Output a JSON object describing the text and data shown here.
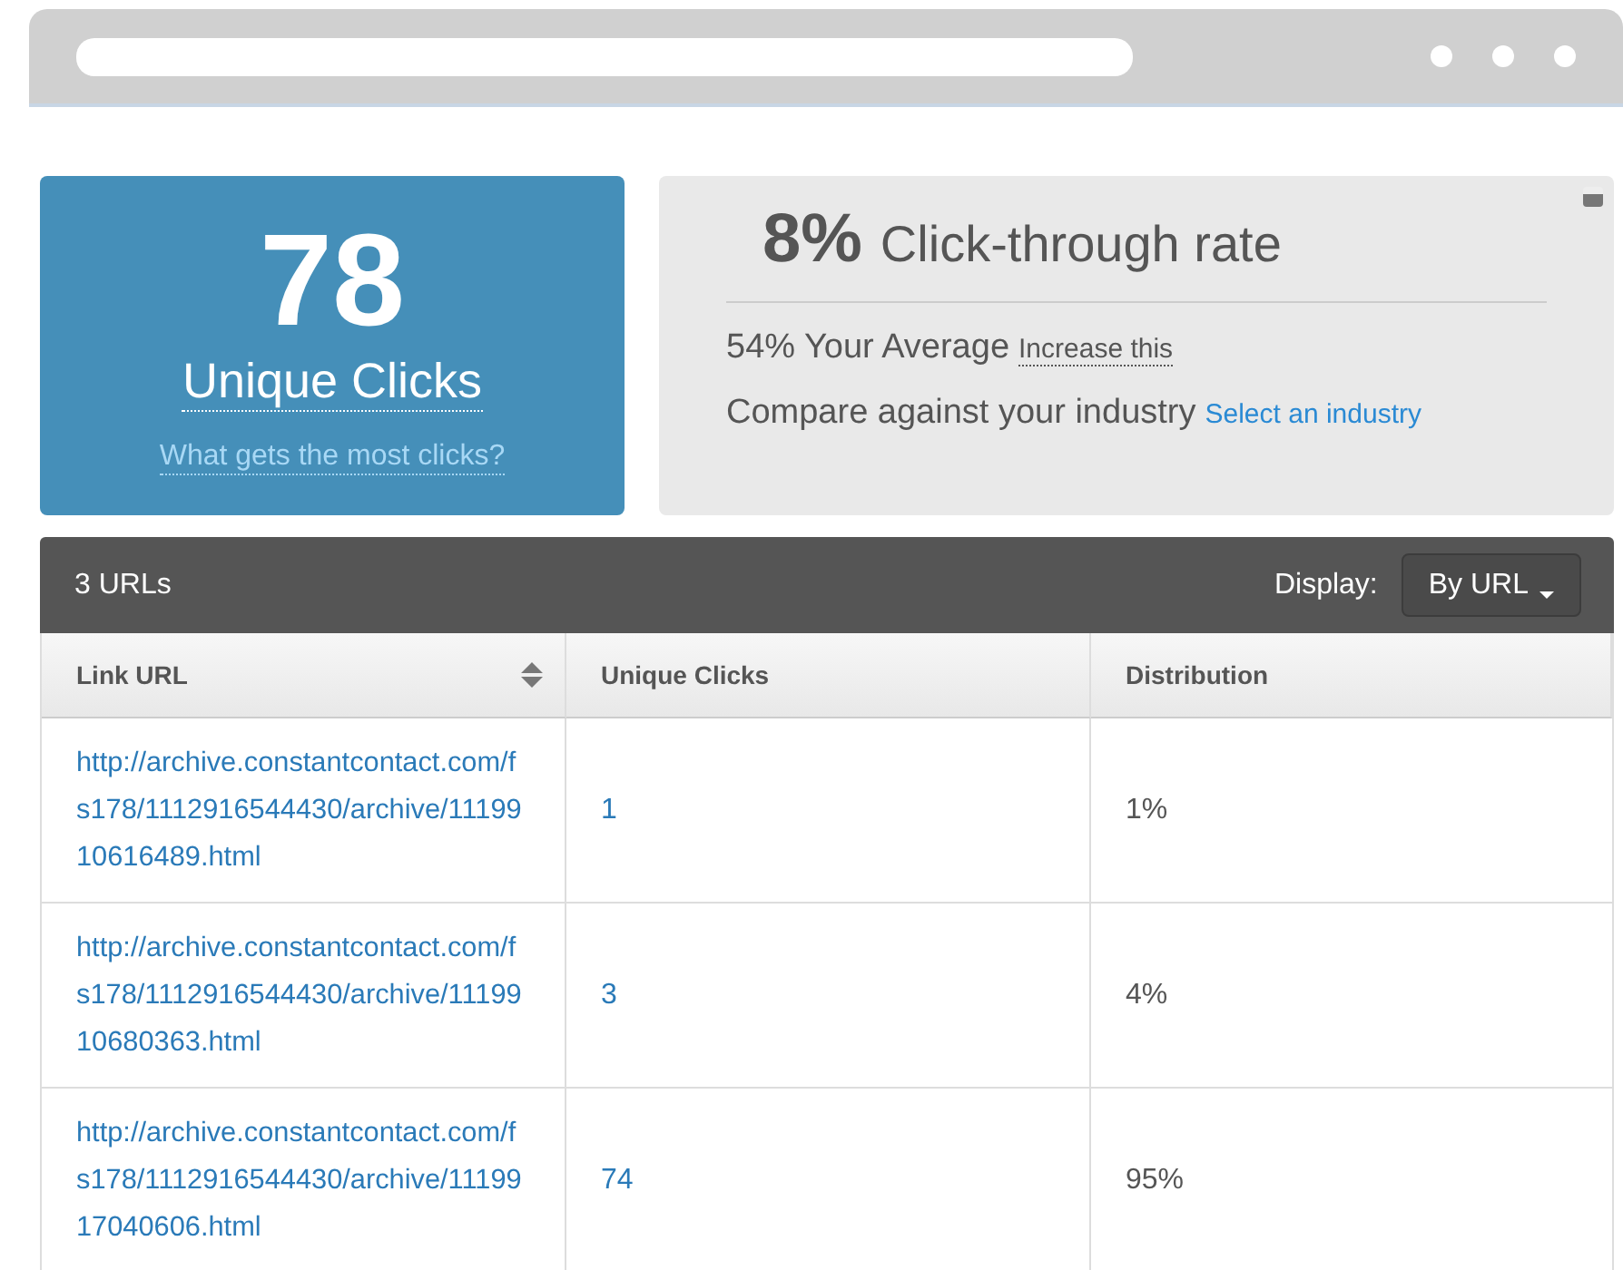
{
  "summary": {
    "count": "78",
    "label": "Unique Clicks",
    "link": "What gets the most clicks?"
  },
  "rate": {
    "value": "8%",
    "label": "Click-through rate",
    "average_value": "54% Your Average",
    "average_link": "Increase this",
    "compare_label": "Compare against your industry",
    "compare_link": "Select an industry"
  },
  "table": {
    "count": "3 URLs",
    "display_label": "Display:",
    "display_value": "By URL",
    "columns": [
      {
        "label": "Link URL",
        "sortable": true
      },
      {
        "label": "Unique Clicks",
        "sortable": false
      },
      {
        "label": "Distribution",
        "sortable": false
      }
    ],
    "rows": [
      {
        "url": "http://archive.constantcontact.com/fs178/1112916544430/archive/1119910616489.html",
        "clicks": "1",
        "distribution": "1%"
      },
      {
        "url": "http://archive.constantcontact.com/fs178/1112916544430/archive/1119910680363.html",
        "clicks": "3",
        "distribution": "4%"
      },
      {
        "url": "http://archive.constantcontact.com/fs178/1112916544430/archive/1119917040606.html",
        "clicks": "74",
        "distribution": "95%"
      }
    ]
  }
}
